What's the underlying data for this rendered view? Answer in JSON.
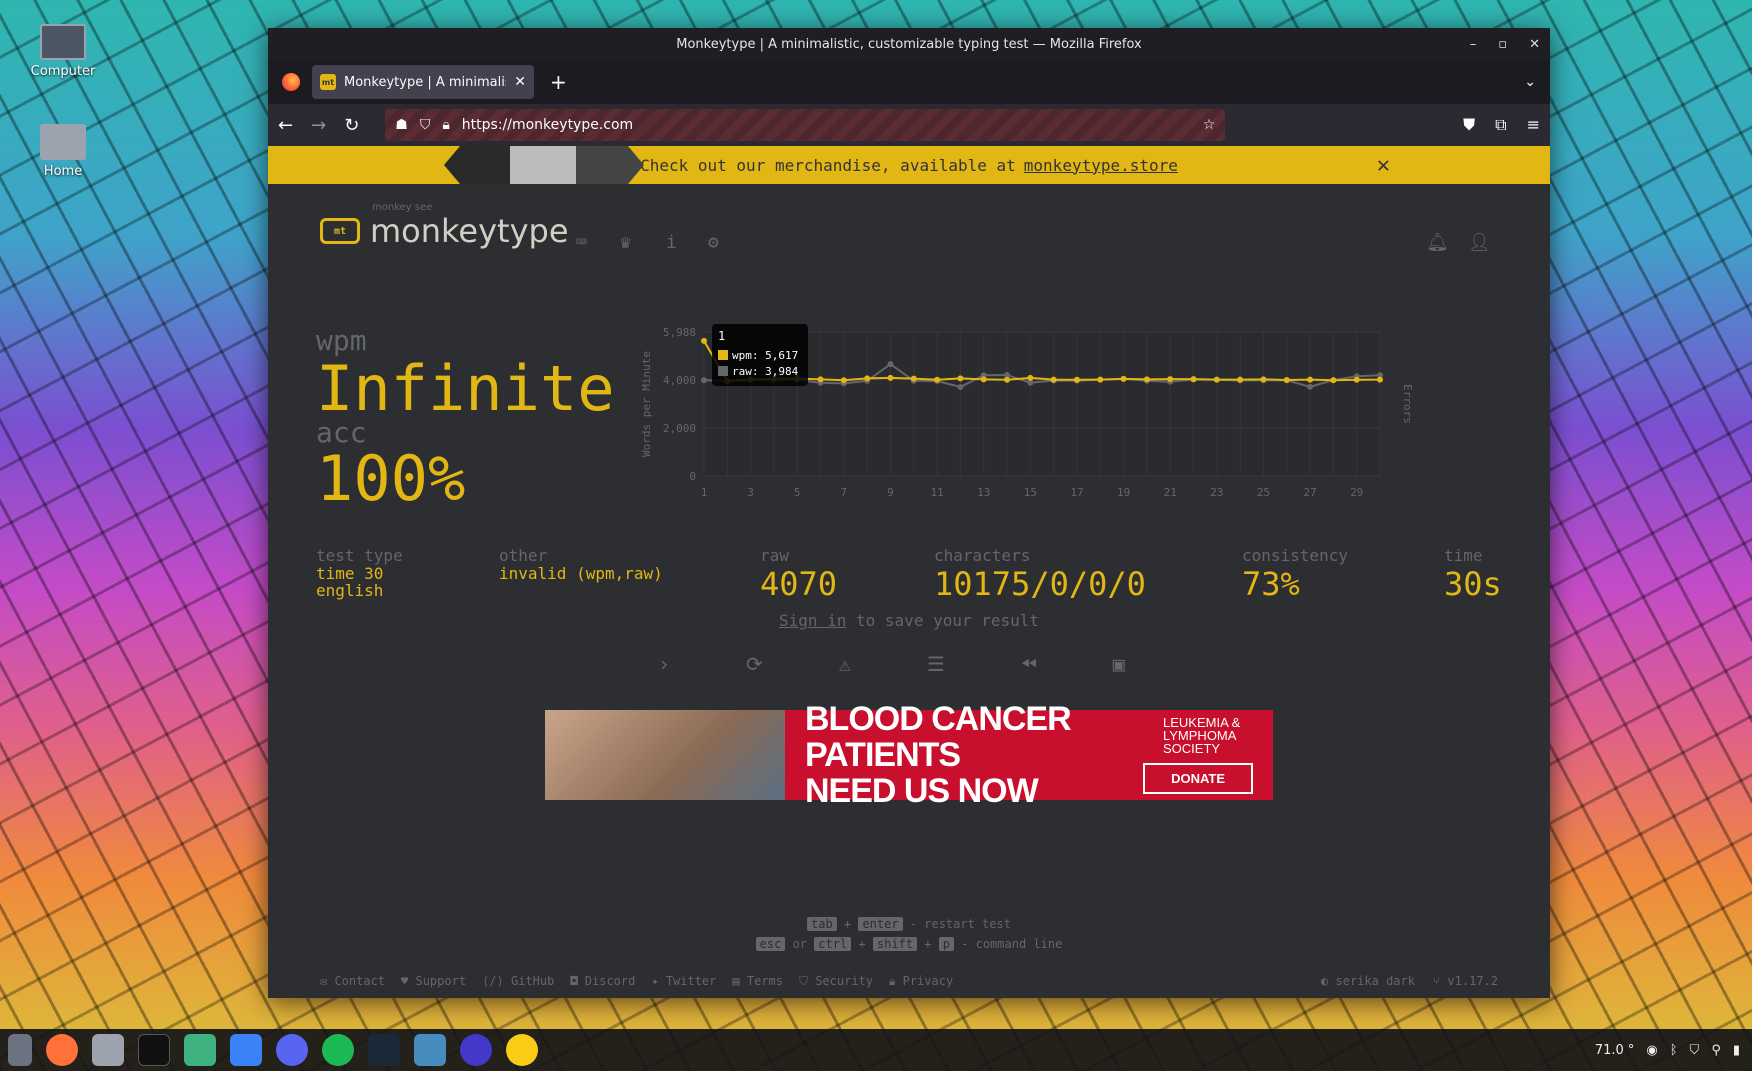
{
  "desktop": {
    "icons": [
      {
        "label": "Computer"
      },
      {
        "label": "Home"
      }
    ]
  },
  "window": {
    "title": "Monkeytype | A minimalistic, customizable typing test — Mozilla Firefox"
  },
  "browser": {
    "tab_title": "Monkeytype | A minimalistic",
    "url": "https://monkeytype.com"
  },
  "banner": {
    "text": "Check out our merchandise, available at",
    "link": "monkeytype.store",
    "close": "✕"
  },
  "header": {
    "logo_mark": "mt",
    "logo_sub": "monkey see",
    "logo_text": "monkeytype"
  },
  "result": {
    "wpm_label": "wpm",
    "wpm_value": "Infinite",
    "acc_label": "acc",
    "acc_value": "100%"
  },
  "stats": {
    "test_type_label": "test type",
    "test_type_1": "time 30",
    "test_type_2": "english",
    "other_label": "other",
    "other_value": "invalid (wpm,raw)",
    "raw_label": "raw",
    "raw_value": "4070",
    "characters_label": "characters",
    "characters_value": "10175/0/0/0",
    "consistency_label": "consistency",
    "consistency_value": "73%",
    "time_label": "time",
    "time_value": "30s"
  },
  "signin": {
    "link": "Sign in",
    "rest": "to save your result"
  },
  "ad": {
    "headline_1": "BLOOD CANCER PATIENTS",
    "headline_2": "NEED US NOW",
    "org": "LEUKEMIA & LYMPHOMA SOCIETY",
    "button": "DONATE"
  },
  "hints": {
    "tab": "tab",
    "plus": "+",
    "enter": "enter",
    "restart": "- restart test",
    "esc": "esc",
    "or": "or",
    "ctrl": "ctrl",
    "shift": "shift",
    "p": "p",
    "command": "- command line"
  },
  "footer": {
    "links": [
      "Contact",
      "Support",
      "GitHub",
      "Discord",
      "Twitter",
      "Terms",
      "Security",
      "Privacy"
    ],
    "theme": "serika dark",
    "version": "v1.17.2"
  },
  "tray": {
    "temp": "71.0 °"
  },
  "chart_data": {
    "type": "line",
    "x": [
      1,
      2,
      3,
      4,
      5,
      6,
      7,
      8,
      9,
      10,
      11,
      12,
      13,
      14,
      15,
      16,
      17,
      18,
      19,
      20,
      21,
      22,
      23,
      24,
      25,
      26,
      27,
      28,
      29,
      30
    ],
    "series": [
      {
        "name": "wpm",
        "color": "#e2b714",
        "values": [
          5617,
          3950,
          4020,
          4040,
          4050,
          4020,
          3980,
          4060,
          4080,
          4050,
          4000,
          4060,
          4020,
          4000,
          4080,
          4010,
          4000,
          4010,
          4040,
          4020,
          4030,
          4030,
          4010,
          4010,
          4020,
          3990,
          4010,
          3980,
          4000,
          4010
        ]
      },
      {
        "name": "raw",
        "color": "#646669",
        "values": [
          3984,
          3960,
          3990,
          3970,
          4000,
          3880,
          3850,
          3960,
          4650,
          3960,
          3950,
          3700,
          4190,
          4200,
          3880,
          3970,
          3960,
          4010,
          4040,
          3960,
          3920,
          4010,
          4000,
          3970,
          3980,
          3980,
          3710,
          3990,
          4150,
          4190
        ]
      }
    ],
    "ylabel": "Words per Minute",
    "y2label": "Errors",
    "yticks": [
      "0",
      "2,000",
      "4,000",
      "5,988"
    ],
    "xticks": [
      "1",
      "3",
      "5",
      "7",
      "9",
      "11",
      "13",
      "15",
      "17",
      "19",
      "21",
      "23",
      "25",
      "27",
      "29"
    ],
    "ylim": [
      0,
      5988
    ],
    "tooltip": {
      "title": "1",
      "wpm": "wpm: 5,617",
      "raw": "raw: 3,984"
    }
  }
}
